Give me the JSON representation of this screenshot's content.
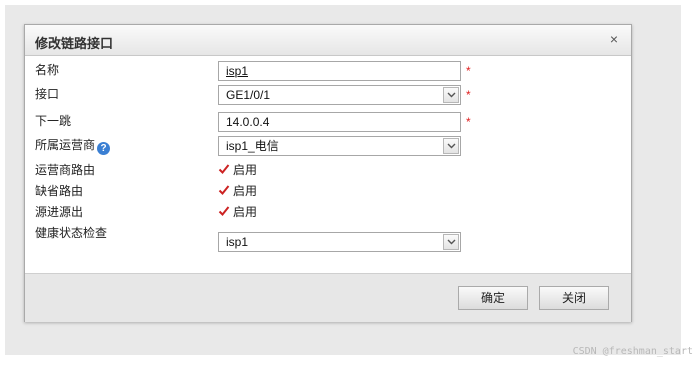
{
  "dialog": {
    "title": "修改链路接口",
    "close_glyph": "×"
  },
  "form": {
    "name": {
      "label": "名称",
      "value": "isp1",
      "required_mark": "*"
    },
    "interface": {
      "label": "接口",
      "value": "GE1/0/1",
      "required_mark": "*"
    },
    "next_hop": {
      "label": "下一跳",
      "value": "14.0.0.4",
      "required_mark": "*"
    },
    "isp": {
      "label": "所属运营商",
      "help_glyph": "?",
      "value": "isp1_电信"
    },
    "isp_route": {
      "label": "运营商路由",
      "checked": true,
      "check_label": "启用"
    },
    "default_route": {
      "label": "缺省路由",
      "checked": true,
      "check_label": "启用"
    },
    "source_in_out": {
      "label": "源进源出",
      "checked": true,
      "check_label": "启用"
    },
    "health_check": {
      "label": "健康状态检查",
      "value": "isp1"
    }
  },
  "footer": {
    "ok_label": "确定",
    "close_label": "关闭"
  },
  "watermark": "CSDN @freshman_start",
  "colors": {
    "required": "#e02020",
    "checkmark": "#cc2222",
    "help_icon": "#3a7fd3"
  }
}
